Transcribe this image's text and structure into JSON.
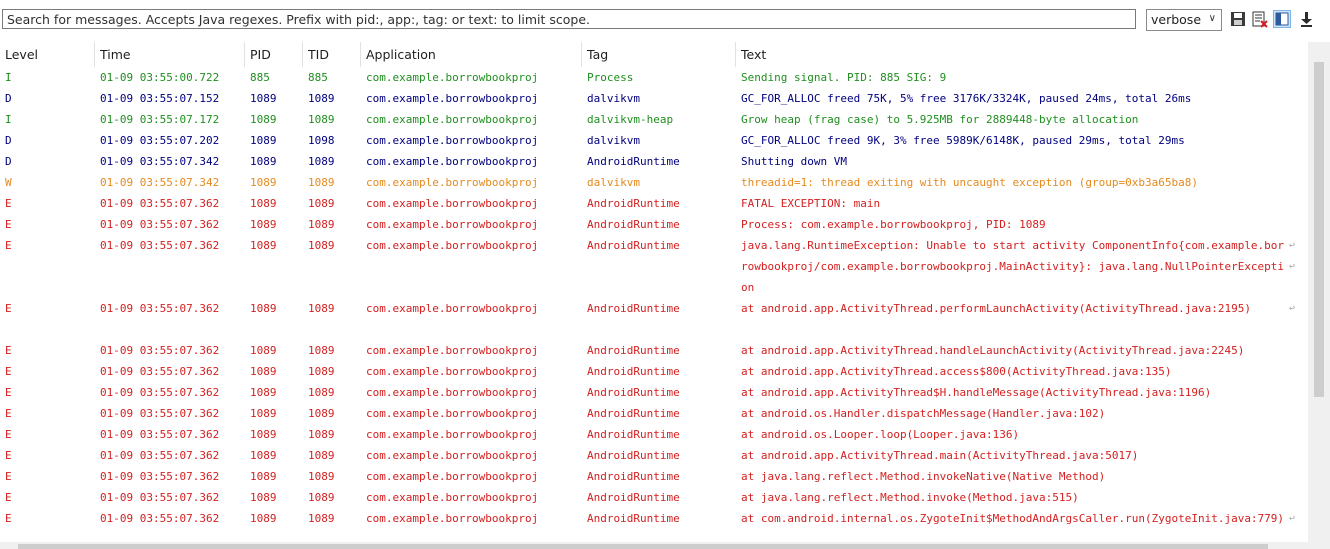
{
  "toolbar": {
    "search_placeholder": "Search for messages. Accepts Java regexes. Prefix with pid:, app:, tag: or text: to limit scope.",
    "level_value": "verbose",
    "icons": [
      "save-icon",
      "clear-log-icon",
      "toggle-columns-icon",
      "scroll-lock-icon"
    ]
  },
  "columns": [
    "Level",
    "Time",
    "PID",
    "TID",
    "Application",
    "Tag",
    "Text"
  ],
  "colors": {
    "I": "#1f8f1f",
    "D": "#00007f",
    "W": "#e58a1f",
    "E": "#d42020"
  },
  "rows": [
    {
      "level": "I",
      "time": "01-09 03:55:00.722",
      "pid": "885",
      "tid": "885",
      "app": "com.example.borrowbookproj",
      "tag": "Process",
      "text": "Sending signal. PID: 885 SIG: 9"
    },
    {
      "level": "D",
      "time": "01-09 03:55:07.152",
      "pid": "1089",
      "tid": "1089",
      "app": "com.example.borrowbookproj",
      "tag": "dalvikvm",
      "text": "GC_FOR_ALLOC freed 75K, 5% free 3176K/3324K, paused 24ms, total 26ms"
    },
    {
      "level": "I",
      "time": "01-09 03:55:07.172",
      "pid": "1089",
      "tid": "1089",
      "app": "com.example.borrowbookproj",
      "tag": "dalvikvm-heap",
      "text": "Grow heap (frag case) to 5.925MB for 2889448-byte allocation"
    },
    {
      "level": "D",
      "time": "01-09 03:55:07.202",
      "pid": "1089",
      "tid": "1098",
      "app": "com.example.borrowbookproj",
      "tag": "dalvikvm",
      "text": "GC_FOR_ALLOC freed 9K, 3% free 5989K/6148K, paused 29ms, total 29ms"
    },
    {
      "level": "D",
      "time": "01-09 03:55:07.342",
      "pid": "1089",
      "tid": "1089",
      "app": "com.example.borrowbookproj",
      "tag": "AndroidRuntime",
      "text": "Shutting down VM"
    },
    {
      "level": "W",
      "time": "01-09 03:55:07.342",
      "pid": "1089",
      "tid": "1089",
      "app": "com.example.borrowbookproj",
      "tag": "dalvikvm",
      "text": "threadid=1: thread exiting with uncaught exception (group=0xb3a65ba8)"
    },
    {
      "level": "E",
      "time": "01-09 03:55:07.362",
      "pid": "1089",
      "tid": "1089",
      "app": "com.example.borrowbookproj",
      "tag": "AndroidRuntime",
      "text": "FATAL EXCEPTION: main"
    },
    {
      "level": "E",
      "time": "01-09 03:55:07.362",
      "pid": "1089",
      "tid": "1089",
      "app": "com.example.borrowbookproj",
      "tag": "AndroidRuntime",
      "text": "Process: com.example.borrowbookproj, PID: 1089"
    },
    {
      "level": "E",
      "time": "01-09 03:55:07.362",
      "pid": "1089",
      "tid": "1089",
      "app": "com.example.borrowbookproj",
      "tag": "AndroidRuntime",
      "text": "java.lang.RuntimeException: Unable to start activity ComponentInfo{com.example.borrowbookproj/com.example.borrowbookproj.MainActivity}: java.lang.NullPointerException"
    },
    {
      "level": "E",
      "time": "01-09 03:55:07.362",
      "pid": "1089",
      "tid": "1089",
      "app": "com.example.borrowbookproj",
      "tag": "AndroidRuntime",
      "text": "at android.app.ActivityThread.performLaunchActivity(ActivityThread.java:2195)"
    },
    {
      "level": "E",
      "time": "01-09 03:55:07.362",
      "pid": "1089",
      "tid": "1089",
      "app": "com.example.borrowbookproj",
      "tag": "AndroidRuntime",
      "text": "at android.app.ActivityThread.handleLaunchActivity(ActivityThread.java:2245)"
    },
    {
      "level": "E",
      "time": "01-09 03:55:07.362",
      "pid": "1089",
      "tid": "1089",
      "app": "com.example.borrowbookproj",
      "tag": "AndroidRuntime",
      "text": "at android.app.ActivityThread.access$800(ActivityThread.java:135)"
    },
    {
      "level": "E",
      "time": "01-09 03:55:07.362",
      "pid": "1089",
      "tid": "1089",
      "app": "com.example.borrowbookproj",
      "tag": "AndroidRuntime",
      "text": "at android.app.ActivityThread$H.handleMessage(ActivityThread.java:1196)"
    },
    {
      "level": "E",
      "time": "01-09 03:55:07.362",
      "pid": "1089",
      "tid": "1089",
      "app": "com.example.borrowbookproj",
      "tag": "AndroidRuntime",
      "text": "at android.os.Handler.dispatchMessage(Handler.java:102)"
    },
    {
      "level": "E",
      "time": "01-09 03:55:07.362",
      "pid": "1089",
      "tid": "1089",
      "app": "com.example.borrowbookproj",
      "tag": "AndroidRuntime",
      "text": "at android.os.Looper.loop(Looper.java:136)"
    },
    {
      "level": "E",
      "time": "01-09 03:55:07.362",
      "pid": "1089",
      "tid": "1089",
      "app": "com.example.borrowbookproj",
      "tag": "AndroidRuntime",
      "text": "at android.app.ActivityThread.main(ActivityThread.java:5017)"
    },
    {
      "level": "E",
      "time": "01-09 03:55:07.362",
      "pid": "1089",
      "tid": "1089",
      "app": "com.example.borrowbookproj",
      "tag": "AndroidRuntime",
      "text": "at java.lang.reflect.Method.invokeNative(Native Method)"
    },
    {
      "level": "E",
      "time": "01-09 03:55:07.362",
      "pid": "1089",
      "tid": "1089",
      "app": "com.example.borrowbookproj",
      "tag": "AndroidRuntime",
      "text": "at java.lang.reflect.Method.invoke(Method.java:515)"
    },
    {
      "level": "E",
      "time": "01-09 03:55:07.362",
      "pid": "1089",
      "tid": "1089",
      "app": "com.example.borrowbookproj",
      "tag": "AndroidRuntime",
      "text": "at com.android.internal.os.ZygoteInit$MethodAndArgsCaller.run(ZygoteInit.java:779)"
    }
  ]
}
